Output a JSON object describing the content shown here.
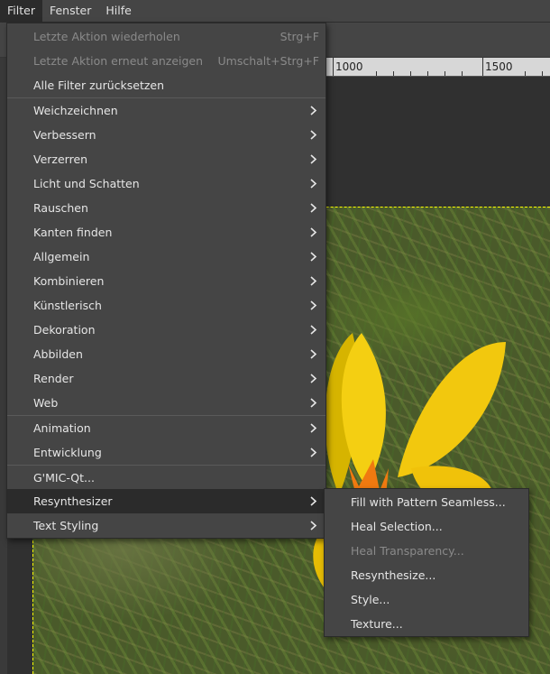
{
  "menubar": {
    "items": [
      {
        "label": "Filter"
      },
      {
        "label": "Fenster"
      },
      {
        "label": "Hilfe"
      }
    ]
  },
  "ruler": {
    "labels": [
      "1000",
      "1500"
    ]
  },
  "filter_menu": {
    "repeat_last": {
      "label": "Letzte Aktion wiederholen",
      "shortcut": "Strg+F"
    },
    "reshow_last": {
      "label": "Letzte Aktion erneut anzeigen",
      "shortcut": "Umschalt+Strg+F"
    },
    "reset_all": {
      "label": "Alle Filter zurücksetzen"
    },
    "categories": [
      {
        "label": "Weichzeichnen"
      },
      {
        "label": "Verbessern"
      },
      {
        "label": "Verzerren"
      },
      {
        "label": "Licht und Schatten"
      },
      {
        "label": "Rauschen"
      },
      {
        "label": "Kanten finden"
      },
      {
        "label": "Allgemein"
      },
      {
        "label": "Kombinieren"
      },
      {
        "label": "Künstlerisch"
      },
      {
        "label": "Dekoration"
      },
      {
        "label": "Abbilden"
      },
      {
        "label": "Render"
      },
      {
        "label": "Web"
      }
    ],
    "animation": {
      "label": "Animation"
    },
    "development": {
      "label": "Entwicklung"
    },
    "gmic": {
      "label": "G'MIC-Qt..."
    },
    "resynthesizer": {
      "label": "Resynthesizer"
    },
    "text_styling": {
      "label": "Text Styling"
    }
  },
  "resynth_submenu": {
    "items": [
      {
        "label": "Fill with Pattern Seamless..."
      },
      {
        "label": "Heal Selection..."
      },
      {
        "label": "Heal Transparency..."
      },
      {
        "label": "Resynthesize..."
      },
      {
        "label": "Style..."
      },
      {
        "label": "Texture..."
      }
    ]
  },
  "colors": {
    "menu_bg": "#454545",
    "highlight": "#2b2b2b",
    "disabled_text": "#8a8a8a",
    "selection_marquee": "#ffff00"
  },
  "icons": {
    "submenu_arrow": "chevron-right-icon"
  }
}
